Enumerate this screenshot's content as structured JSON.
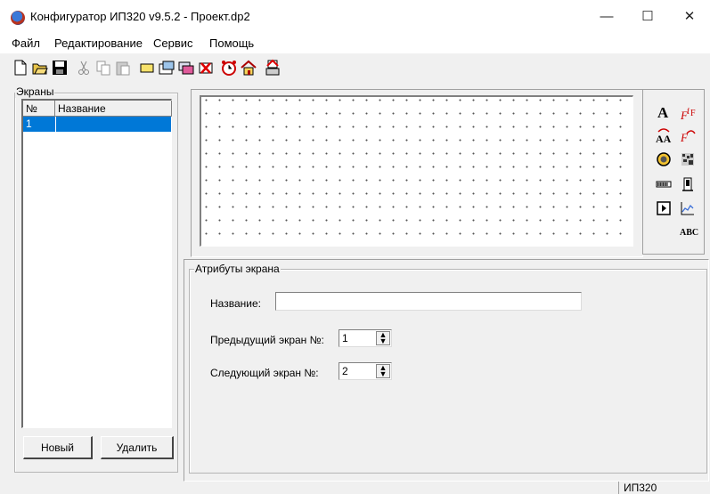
{
  "window": {
    "title": "Конфигуратор ИП320 v9.5.2 - Проект.dp2",
    "minimize_glyph": "—",
    "maximize_glyph": "☐",
    "close_glyph": "✕"
  },
  "menu": [
    "Файл",
    "Редактирование",
    "Сервис",
    "Помощь"
  ],
  "toolbar": {
    "icons": [
      "new-file-icon",
      "open-folder-icon",
      "save-disk-icon",
      "cut-icon",
      "copy-icon",
      "paste-icon",
      "add-screen-icon",
      "screen-properties-icon",
      "copy-screen-icon",
      "delete-screen-icon",
      "alarm-clock-icon",
      "home-screen-icon",
      "print-icon"
    ]
  },
  "screens_panel": {
    "title": "Экраны",
    "columns": [
      "№",
      "Название"
    ],
    "rows": [
      {
        "num": "1",
        "name": ""
      }
    ],
    "new_button": "Новый",
    "delete_button": "Удалить"
  },
  "palette": {
    "icons": [
      "text-tool-icon",
      "formula-tool-icon",
      "text-swap-tool-icon",
      "formula-swap-tool-icon",
      "indicator-tool-icon",
      "bitmap-tool-icon",
      "bargraph-tool-icon",
      "pump-tool-icon",
      "button-tool-icon",
      "trend-tool-icon",
      "abc-tool-icon"
    ],
    "abc_label": "ABC",
    "text_label": "A"
  },
  "attributes": {
    "title": "Атрибуты экрана",
    "name_label": "Название:",
    "name_value": "",
    "prev_label": "Предыдущий экран №:",
    "prev_value": "1",
    "next_label": "Следующий экран №:",
    "next_value": "2"
  },
  "status": {
    "device": "ИП320"
  },
  "colors": {
    "selection": "#0078d7",
    "background": "#f0f0f0"
  }
}
